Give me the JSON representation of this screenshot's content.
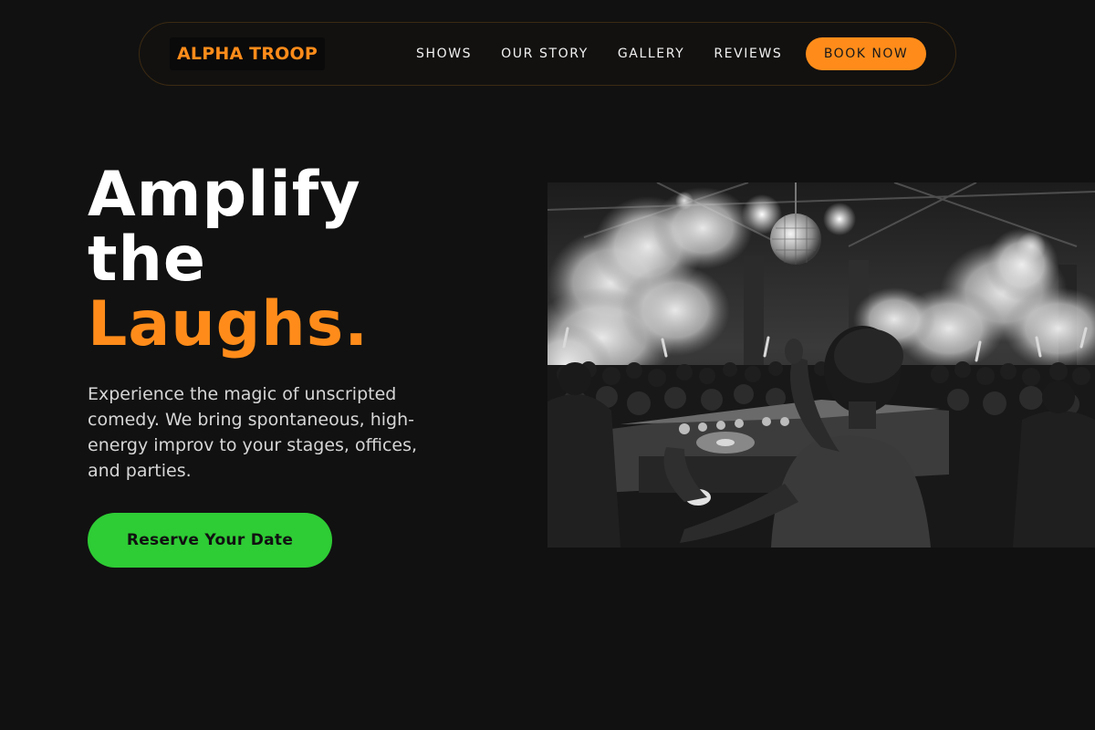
{
  "nav": {
    "logo": "ALPHA TROOP",
    "links": [
      "SHOWS",
      "OUR STORY",
      "GALLERY",
      "REVIEWS"
    ],
    "cta": "BOOK NOW"
  },
  "hero": {
    "title_line1": "Amplify",
    "title_line2": "the",
    "title_accent": "Laughs.",
    "description": "Experience the magic of unscripted comedy. We bring spontaneous, high-energy improv to your stages, offices, and parties.",
    "cta": "Reserve Your Date"
  },
  "colors": {
    "background": "#111111",
    "accent": "#ff8c1a",
    "cta_green": "#2ecc35"
  }
}
